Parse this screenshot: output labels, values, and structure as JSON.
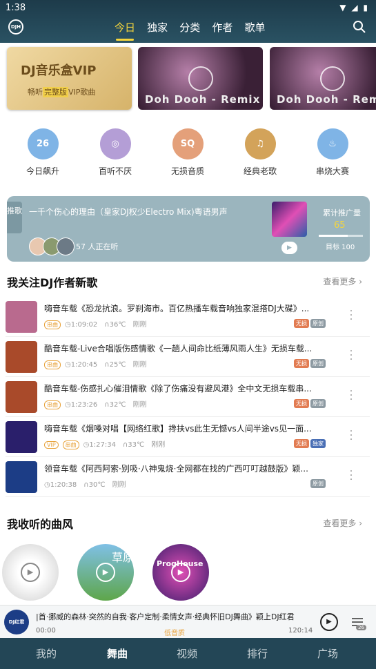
{
  "status": {
    "time": "1:38",
    "icons": "▼ ◢ ▮"
  },
  "header": {
    "logo_text": "DJH",
    "tabs": [
      {
        "label": "今日"
      },
      {
        "label": "独家"
      },
      {
        "label": "分类"
      },
      {
        "label": "作者"
      },
      {
        "label": "歌单"
      }
    ]
  },
  "banners": {
    "vip_title": "DJ音乐盒VIP",
    "vip_sub_pre": "畅听",
    "vip_sub_hl": "完整版",
    "vip_sub_post": "VIP歌曲",
    "mix1": "Doh Dooh - Remix",
    "mix2": "Doh Dooh - Rem"
  },
  "categories": [
    {
      "label": "今日飙升",
      "icon": "calendar-icon",
      "glyph": "26",
      "color": "#7fb4e6"
    },
    {
      "label": "百听不厌",
      "icon": "disc-icon",
      "glyph": "◎",
      "color": "#b49ed6"
    },
    {
      "label": "无损音质",
      "icon": "headphones-icon",
      "glyph": "SQ",
      "color": "#e4a07a"
    },
    {
      "label": "经典老歌",
      "icon": "gramophone-icon",
      "glyph": "♫",
      "color": "#d3a35a"
    },
    {
      "label": "串烧大赛",
      "icon": "flame-icon",
      "glyph": "♨",
      "color": "#7fb4e6"
    }
  ],
  "push": {
    "tag": "推歌",
    "title": "一千个伤心的理由（皇家DJ权少Electro Mix)粤语男声",
    "listening": "57 人正在听",
    "promo_label": "累计推广量",
    "promo_value": "65",
    "progress": 0.65,
    "goal": "目标 100"
  },
  "section1": {
    "title": "我关注DJ作者新歌",
    "more": "查看更多 ›"
  },
  "songs": [
    {
      "title": "嗨音车载《恐龙抗浪。罗刹海市。百亿热播车载音响独家混搭DJ大碟》...",
      "badge1": "串曲",
      "badge2": "",
      "duration": "1:09:02",
      "temp": "36℃",
      "time": "刚刚",
      "tags": [
        "无损",
        "原创"
      ],
      "colors": [
        "#e27c52",
        "#8d9aa2"
      ],
      "cover": "#b96a8e"
    },
    {
      "title": "酷音车载-Live合唱版伤感情歌《一趟人间命比纸薄风雨人生》无损车载...",
      "badge1": "串曲",
      "badge2": "",
      "duration": "1:20:45",
      "temp": "25℃",
      "time": "刚刚",
      "tags": [
        "无损",
        "原创"
      ],
      "colors": [
        "#e27c52",
        "#8d9aa2"
      ],
      "cover": "#a94a2a"
    },
    {
      "title": "酷音车载-伤感扎心催泪情歌《除了伤痛没有避风港》全中文无损车载串...",
      "badge1": "串曲",
      "badge2": "",
      "duration": "1:23:26",
      "temp": "32℃",
      "time": "刚刚",
      "tags": [
        "无损",
        "原创"
      ],
      "colors": [
        "#e27c52",
        "#8d9aa2"
      ],
      "cover": "#a94a2a"
    },
    {
      "title": "嗨音车载《烟嗓对唱【网络红歌】搀扶vs此生无憾vs人间半途vs见一面...",
      "badge1": "VIP",
      "badge2": "串曲",
      "duration": "1:27:34",
      "temp": "33℃",
      "time": "刚刚",
      "tags": [
        "无损",
        "独家"
      ],
      "colors": [
        "#e27c52",
        "#4a6fb5"
      ],
      "cover": "#2a1f6b"
    },
    {
      "title": "领音车载《阿西阿索·别吸·八神鬼烧·全网都在找的广西叮叮越鼓版》颖...",
      "badge1": "",
      "badge2": "",
      "duration": "1:20:38",
      "temp": "30℃",
      "time": "刚刚",
      "tags": [
        "原创"
      ],
      "colors": [
        "#8d9aa2"
      ],
      "cover": "#1c3d86"
    }
  ],
  "section2": {
    "title": "我收听的曲风",
    "more": "查看更多 ›"
  },
  "styles": [
    {
      "label": "",
      "color": "#d9d9d9"
    },
    {
      "label": "草原",
      "color": "#5ea64a"
    },
    {
      "label": "ProgHouse",
      "color": "#7a2fa8"
    }
  ],
  "player": {
    "cover": "DJ红君",
    "title": "|首·挪威的森林·突然的自我·客户定制·柔情女声·经典怀旧DJ舞曲》颖上DJ红君",
    "elapsed": "00:00",
    "quality": "低音质",
    "total": "120:14",
    "queue_count": "26"
  },
  "nav": [
    {
      "label": "我的"
    },
    {
      "label": "舞曲"
    },
    {
      "label": "视频"
    },
    {
      "label": "排行"
    },
    {
      "label": "广场"
    }
  ]
}
